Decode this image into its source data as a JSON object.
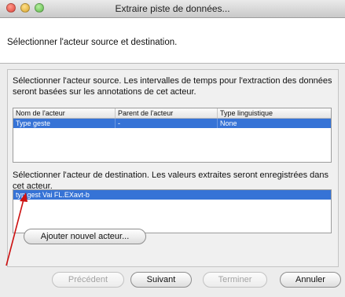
{
  "window": {
    "title": "Extraire piste de données..."
  },
  "header": {
    "instruction": "Sélectionner l'acteur source et destination."
  },
  "source": {
    "description": "Sélectionner l'acteur source. Les intervalles de temps pour l'extraction des données seront basées sur les annotations de cet acteur.",
    "columns": [
      "Nom de l'acteur",
      "Parent de l'acteur",
      "Type linguistique"
    ],
    "rows": [
      [
        "Type geste",
        "-",
        "None"
      ]
    ]
  },
  "destination": {
    "description": "Sélectionner l'acteur de destination. Les valeurs extraites seront enregistrées dans cet acteur.",
    "items": [
      "typ gest Vai FL.EXavt-b"
    ]
  },
  "buttons": {
    "add_tier": "Ajouter nouvel acteur...",
    "previous": "Précédent",
    "next": "Suivant",
    "finish": "Terminer",
    "cancel": "Annuler"
  },
  "colors": {
    "selection": "#3673d6",
    "annotation_arrow": "#cc1111"
  }
}
